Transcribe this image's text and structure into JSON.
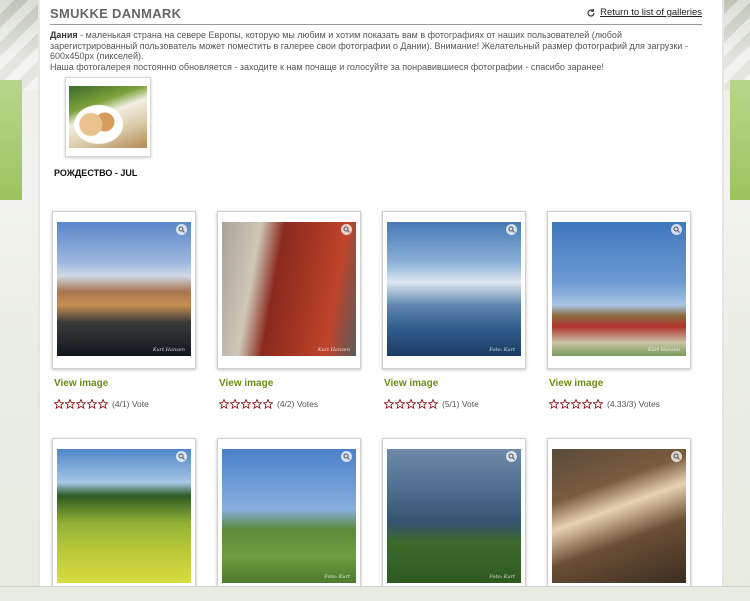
{
  "header": {
    "brand": "SMUKKE DANMARK",
    "return_link": "Return to list of galleries"
  },
  "description": {
    "bold": "Дания",
    "line1": " - маленькая страна на севере Европы, которую мы любим и хотим показать вам в фотографиях от наших пользователей (любой зарегистрированный пользователь может поместить в галерее свои фотографии о Дании). Внимание! Желательный размер фотографий для загрузки - 600х450px (пикселей).",
    "line2": "Наша фотогалерея постоянно обновляется - заходите к нам почаще и голосуйте за понравившиеся фотографии - спасибо заранее!"
  },
  "gallery": {
    "title": "РОЖДЕСТВО - JUL"
  },
  "cards": [
    {
      "view_label": "View image",
      "votes": "(4/1) Vote",
      "rating": 0,
      "watermark": "Kurt Hansen"
    },
    {
      "view_label": "View image",
      "votes": "(4/2) Votes",
      "rating": 0,
      "watermark": "Kurt Hansen"
    },
    {
      "view_label": "View image",
      "votes": "(5/1) Vote",
      "rating": 0,
      "watermark": "Foto: Kurt"
    },
    {
      "view_label": "View image",
      "votes": "(4.33/3) Votes",
      "rating": 0,
      "watermark": "Kurt Hansen"
    },
    {
      "view_label": "",
      "votes": "",
      "rating": 0,
      "watermark": ""
    },
    {
      "view_label": "",
      "votes": "",
      "rating": 0,
      "watermark": "Foto: Kurt"
    },
    {
      "view_label": "",
      "votes": "",
      "rating": 0,
      "watermark": "Foto: Kurt"
    },
    {
      "view_label": "",
      "votes": "",
      "rating": 0,
      "watermark": ""
    }
  ],
  "colors": {
    "accent_green": "#6d8b16",
    "star_outline": "#8b1a1a"
  },
  "icons": {
    "return": "refresh-arrow-icon",
    "zoom": "magnifier-icon",
    "star": "star-outline-icon"
  }
}
